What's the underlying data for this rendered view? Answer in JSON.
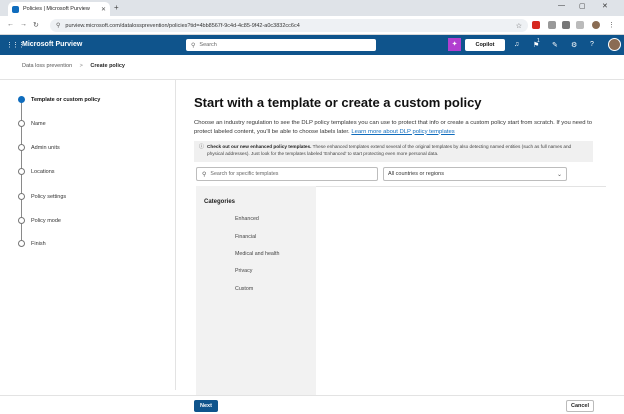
{
  "browser": {
    "tab_title": "Policies | Microsoft Purview",
    "tab_close": "✕",
    "new_tab": "+",
    "url": "purview.microsoft.com/datalossprevention/policies?tid=4bb8567f-9c4d-4c85-9f42-a0c3832cc6c4",
    "window_controls": [
      "—",
      "▢",
      "✕"
    ]
  },
  "app": {
    "name": "Microsoft Purview",
    "search_placeholder": "Search",
    "copilot_label": "Copilot",
    "notification_badge": "1"
  },
  "breadcrumb": {
    "items": [
      "Data loss prevention",
      "Create policy"
    ],
    "separator": ">"
  },
  "wizard": {
    "steps": [
      {
        "label": "Template or custom policy",
        "active": true
      },
      {
        "label": "Name",
        "active": false
      },
      {
        "label": "Admin units",
        "active": false
      },
      {
        "label": "Locations",
        "active": false
      },
      {
        "label": "Policy settings",
        "active": false
      },
      {
        "label": "Policy mode",
        "active": false
      },
      {
        "label": "Finish",
        "active": false
      }
    ]
  },
  "main": {
    "title": "Start with a template or create a custom policy",
    "description": "Choose an industry regulation to see the DLP policy templates you can use to protect that info or create a custom policy start from scratch. If you need to protect labeled content, you'll be able to choose labels later.",
    "description_link": "Learn more about DLP policy templates",
    "info_bold": "Check out our new enhanced policy templates.",
    "info_text": "These enhanced templates extend several of the original templates by also detecting named entities (such as full names and physical addresses). Just look for the templates labeled 'Enhanced' to start protecting even more personal data.",
    "template_search_placeholder": "Search for specific templates",
    "region_value": "All countries or regions",
    "categories_heading": "Categories",
    "categories": [
      "Enhanced",
      "Financial",
      "Medical and health",
      "Privacy",
      "Custom"
    ]
  },
  "footer": {
    "next_label": "Next",
    "cancel_label": "Cancel"
  },
  "colors": {
    "app_bar": "#0f548c",
    "accent": "#0f6cbd",
    "copilot_square": "#b13fcf"
  }
}
